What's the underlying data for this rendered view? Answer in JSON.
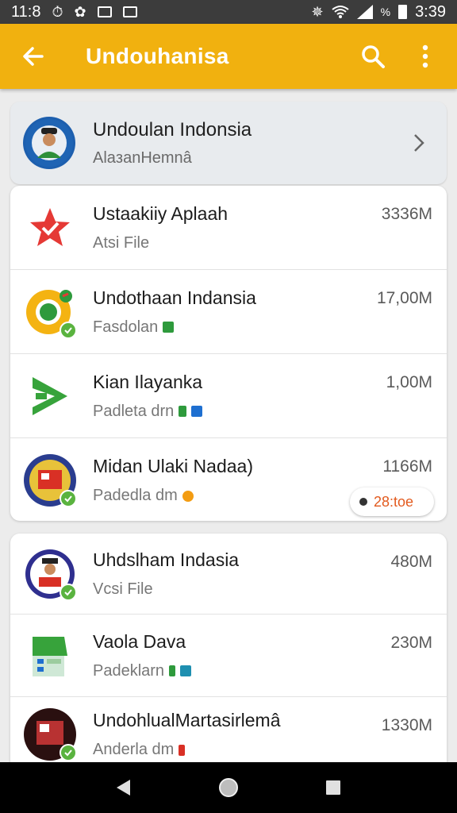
{
  "status": {
    "time_left": "11:8",
    "percent": "%",
    "time_right": "3:39"
  },
  "appbar": {
    "title": "Undouhanisa"
  },
  "header": {
    "title": "Undoulan Indonsia",
    "subtitle": "AlaзanHemnâ"
  },
  "list1": [
    {
      "title": "Ustaakiiy Aplaah",
      "subtitle": "Atsi File",
      "size": "3336M",
      "icon": "red-star-icon"
    },
    {
      "title": "Undothaan Indansia",
      "subtitle": "Fasdolan",
      "size": "17,00M",
      "icon": "yellow-ring-icon"
    },
    {
      "title": "Kian Ilayanka",
      "subtitle": "Padleta drn",
      "size": "1,00M",
      "icon": "green-play-icon"
    },
    {
      "title": "Midan Ulaki Nadaa)",
      "subtitle": "Padedla dm",
      "size": "1166M",
      "icon": "badge-emblem-icon",
      "progress": "28:toe"
    }
  ],
  "list2": [
    {
      "title": "Uhdslham Indasia",
      "subtitle": "Vcsi File",
      "size": "480M",
      "icon": "portrait-emblem-icon"
    },
    {
      "title": "Vaola Dava",
      "subtitle": "Padeklarn",
      "size": "230M",
      "icon": "green-sheet-icon"
    },
    {
      "title": "UndohlualMartasirlemâ",
      "subtitle": "Anderla dm",
      "size": "1330M",
      "icon": "dark-emblem-icon"
    }
  ],
  "colors": {
    "accent": "#f1b10f",
    "check": "#5ab33f",
    "progress_text": "#e25a1e"
  }
}
